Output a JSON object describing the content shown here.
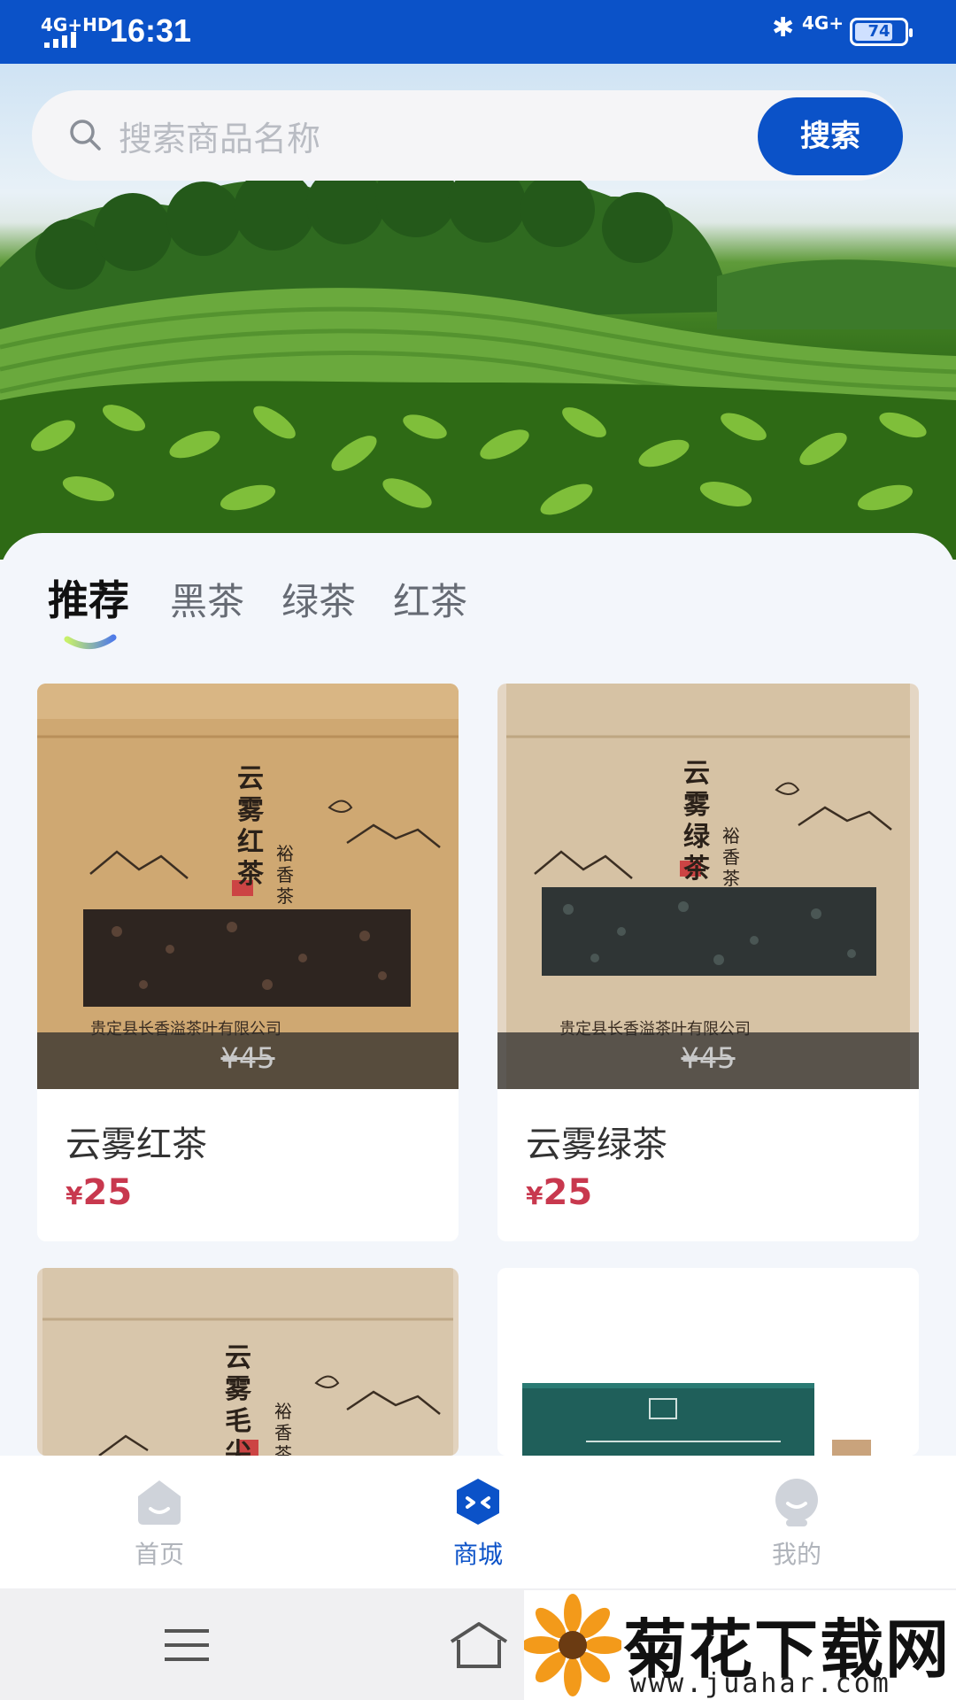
{
  "status_bar": {
    "network_left": "4G+HD",
    "time": "16:31",
    "network_right": "4G+",
    "battery_level": "74",
    "bluetooth_glyph": "✱"
  },
  "search": {
    "placeholder": "搜索商品名称",
    "button_label": "搜索"
  },
  "tabs": [
    {
      "label": "推荐",
      "active": true
    },
    {
      "label": "黑茶",
      "active": false
    },
    {
      "label": "绿茶",
      "active": false
    },
    {
      "label": "红茶",
      "active": false
    }
  ],
  "products": [
    {
      "name": "云雾红茶",
      "currency": "¥",
      "price": "25",
      "original_price": "¥45",
      "bag_title": "云雾红茶",
      "bag_brand": "裕香茶",
      "bag_company": "贵定县长香溢茶叶有限公司"
    },
    {
      "name": "云雾绿茶",
      "currency": "¥",
      "price": "25",
      "original_price": "¥45",
      "bag_title": "云雾绿茶",
      "bag_brand": "裕香茶",
      "bag_company": "贵定县长香溢茶叶有限公司"
    },
    {
      "bag_title": "云雾毛尖",
      "bag_brand": "裕香茶"
    },
    {}
  ],
  "bottom_nav": [
    {
      "label": "首页",
      "icon": "home-icon",
      "active": false
    },
    {
      "label": "商城",
      "icon": "shop-icon",
      "active": true
    },
    {
      "label": "我的",
      "icon": "profile-icon",
      "active": false
    }
  ],
  "watermark": {
    "title": "菊花下载网",
    "url": "www.juahar.com"
  },
  "colors": {
    "brand_blue": "#0b52c8",
    "price_red": "#c8384e",
    "page_bg": "#f3f6fb"
  }
}
